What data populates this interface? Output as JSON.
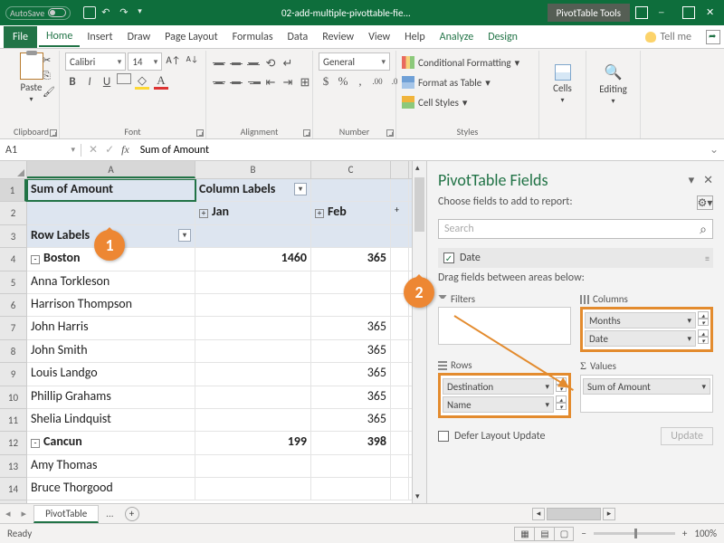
{
  "titlebar": {
    "autosave": "AutoSave",
    "filename": "02-add-multiple-pivottable-fie...",
    "tools": "PivotTable Tools"
  },
  "menu": {
    "file": "File",
    "home": "Home",
    "insert": "Insert",
    "draw": "Draw",
    "pagelayout": "Page Layout",
    "formulas": "Formulas",
    "data": "Data",
    "review": "Review",
    "view": "View",
    "help": "Help",
    "analyze": "Analyze",
    "design": "Design",
    "tell": "Tell me"
  },
  "ribbon": {
    "clipboard": {
      "label": "Clipboard",
      "paste": "Paste"
    },
    "font": {
      "label": "Font",
      "name": "Calibri",
      "size": "14"
    },
    "alignment": {
      "label": "Alignment"
    },
    "number": {
      "label": "Number",
      "format": "General"
    },
    "styles": {
      "label": "Styles",
      "cf": "Conditional Formatting",
      "fat": "Format as Table",
      "cs": "Cell Styles"
    },
    "cells": {
      "label": "Cells"
    },
    "editing": {
      "label": "Editing"
    }
  },
  "formula_bar": {
    "cell": "A1",
    "value": "Sum of Amount"
  },
  "columns": [
    "A",
    "B",
    "C"
  ],
  "grid": {
    "a1": "Sum of Amount",
    "b1": "Column Labels",
    "b2": "Jan",
    "c2": "Feb",
    "a3": "Row Labels",
    "a4": "Boston",
    "b4": "1460",
    "c4": "365",
    "a5": "Anna Torkleson",
    "a6": "Harrison Thompson",
    "a7": "John Harris",
    "c7": "365",
    "a8": "John Smith",
    "c8": "365",
    "a9": "Louis Landgo",
    "c9": "365",
    "a10": "Phillip Grahams",
    "c10": "365",
    "a11": "Shelia Lindquist",
    "c11": "365",
    "a12": "Cancun",
    "b12": "199",
    "c12": "398",
    "a13": "Amy Thomas",
    "a14": "Bruce Thorgood"
  },
  "pane": {
    "title": "PivotTable Fields",
    "subtitle": "Choose fields to add to report:",
    "search": "Search",
    "field_date": "Date",
    "drag_note": "Drag fields between areas below:",
    "filters": "Filters",
    "columns": "Columns",
    "rows": "Rows",
    "values": "Values",
    "col_months": "Months",
    "col_date": "Date",
    "row_dest": "Destination",
    "row_name": "Name",
    "val_sum": "Sum of Amount",
    "defer": "Defer Layout Update",
    "update": "Update"
  },
  "tabs": {
    "pivot": "PivotTable",
    "dots": "..."
  },
  "status": {
    "ready": "Ready",
    "zoom": "100%"
  },
  "callouts": {
    "c1": "1",
    "c2": "2"
  }
}
